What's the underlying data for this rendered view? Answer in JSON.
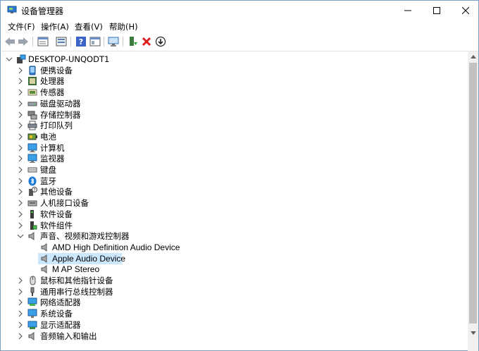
{
  "window": {
    "title": "设备管理器"
  },
  "menu": [
    "文件(F)",
    "操作(A)",
    "查看(V)",
    "帮助(H)"
  ],
  "toolbar_icons": [
    "back-arrow-icon",
    "forward-arrow-icon",
    "properties-icon",
    "show-hidden-icon",
    "help-icon",
    "update-view-icon",
    "scan-hardware-icon",
    "add-driver-icon",
    "uninstall-icon",
    "disable-device-icon"
  ],
  "tree": {
    "root": "DESKTOP-UNQODT1",
    "categories": [
      {
        "label": "便携设备",
        "icon": "portable-device-icon"
      },
      {
        "label": "处理器",
        "icon": "processor-icon"
      },
      {
        "label": "传感器",
        "icon": "sensor-icon"
      },
      {
        "label": "磁盘驱动器",
        "icon": "disk-drive-icon"
      },
      {
        "label": "存储控制器",
        "icon": "storage-controller-icon"
      },
      {
        "label": "打印队列",
        "icon": "printer-icon"
      },
      {
        "label": "电池",
        "icon": "battery-icon"
      },
      {
        "label": "计算机",
        "icon": "computer-icon"
      },
      {
        "label": "监视器",
        "icon": "monitor-icon"
      },
      {
        "label": "键盘",
        "icon": "keyboard-icon"
      },
      {
        "label": "蓝牙",
        "icon": "bluetooth-icon"
      },
      {
        "label": "其他设备",
        "icon": "unknown-device-icon"
      },
      {
        "label": "人机接口设备",
        "icon": "hid-icon"
      },
      {
        "label": "软件设备",
        "icon": "software-device-icon"
      },
      {
        "label": "软件组件",
        "icon": "software-component-icon"
      },
      {
        "label": "声音、视频和游戏控制器",
        "icon": "speaker-icon",
        "expanded": true,
        "children": [
          "AMD High Definition Audio Device",
          "Apple Audio Device",
          "M AP Stereo"
        ]
      },
      {
        "label": "鼠标和其他指针设备",
        "icon": "mouse-icon"
      },
      {
        "label": "通用串行总线控制器",
        "icon": "usb-icon"
      },
      {
        "label": "网络适配器",
        "icon": "network-adapter-icon"
      },
      {
        "label": "系统设备",
        "icon": "system-device-icon"
      },
      {
        "label": "显示适配器",
        "icon": "display-adapter-icon"
      },
      {
        "label": "音频输入和输出",
        "icon": "audio-io-icon"
      }
    ],
    "selected": "Apple Audio Device"
  },
  "colors": {
    "selection": "#cce8ff",
    "accent": "#0078d7"
  }
}
